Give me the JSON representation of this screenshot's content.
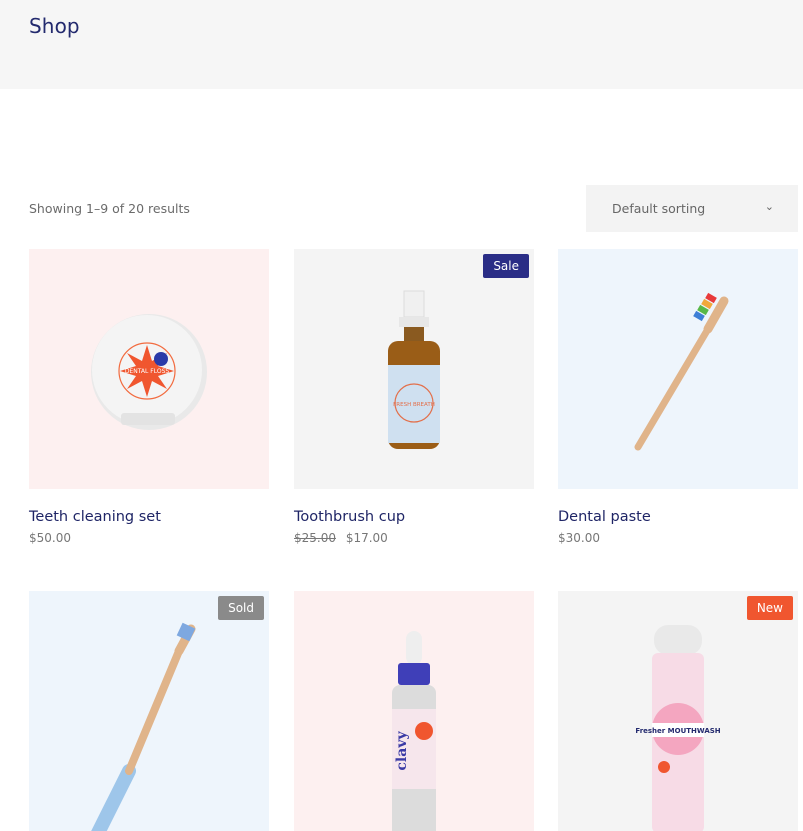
{
  "page": {
    "title": "Shop"
  },
  "toolbar": {
    "result_count": "Showing 1–9 of 20 results",
    "sort_selected": "Default sorting",
    "sort_icon": "chevron-down-icon"
  },
  "colors": {
    "accent": "#232a6e",
    "sale": "#2a2d86",
    "sold": "#8a8a8a",
    "new": "#f0562f"
  },
  "products": [
    {
      "title": "Teeth cleaning set",
      "price": "$50.00",
      "image": "dental-floss-case",
      "image_text": "DENTAL FLOSS"
    },
    {
      "title": "Toothbrush cup",
      "old_price": "$25.00",
      "price": "$17.00",
      "badge": "Sale",
      "image": "amber-spray-bottle",
      "image_text": "FRESH BREATH"
    },
    {
      "title": "Dental paste",
      "price": "$30.00",
      "image": "bamboo-toothbrush-rainbow"
    },
    {
      "badge": "Sold",
      "image": "bamboo-toothbrush-blue"
    },
    {
      "image": "dropper-bottle",
      "image_text": "clavy"
    },
    {
      "badge": "New",
      "image": "mouthwash-can",
      "image_text": "Fresher MOUTHWASH"
    }
  ]
}
